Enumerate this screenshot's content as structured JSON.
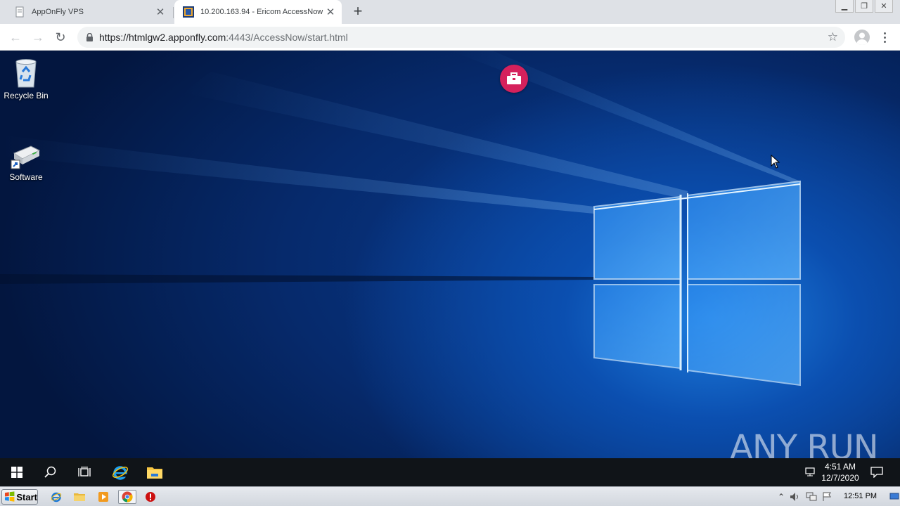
{
  "browser": {
    "tabs": [
      {
        "title": "AppOnFly VPS",
        "active": false
      },
      {
        "title": "10.200.163.94 - Ericom AccessNow",
        "active": true
      }
    ],
    "new_tab_label": "+",
    "url_host": "https://htmlgw2.apponfly.com",
    "url_rest": ":4443/AccessNow/start.html"
  },
  "desktop": {
    "icons": [
      {
        "label": "Recycle Bin",
        "icon": "recycle-bin-icon"
      },
      {
        "label": "Software",
        "icon": "drive-shortcut-icon"
      }
    ],
    "toolbox_button": "toolbox-icon",
    "watermark": "ANY RUN"
  },
  "remote_taskbar": {
    "time": "4:51 AM",
    "date": "12/7/2020",
    "pinned": [
      "start-icon",
      "search-icon",
      "task-view-icon",
      "internet-explorer-icon",
      "file-explorer-icon"
    ]
  },
  "host_taskbar": {
    "start_label": "Start",
    "time": "12:51 PM",
    "quick_launch": [
      "internet-explorer-icon",
      "folder-icon",
      "media-player-icon",
      "chrome-icon",
      "stop-icon"
    ]
  },
  "colors": {
    "toolbox": "#d5215c",
    "desktop_blue": "#0b4fb0",
    "tabstrip": "#dee1e6"
  }
}
